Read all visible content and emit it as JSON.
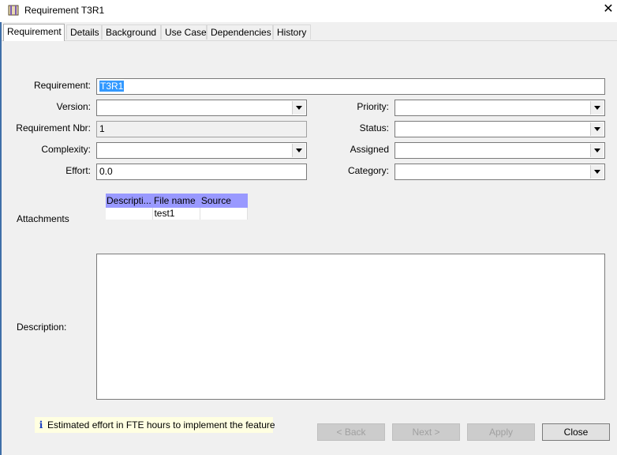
{
  "window": {
    "title": "Requirement T3R1",
    "close_glyph": "✕",
    "icon": "requirement-window-icon"
  },
  "tabs": [
    {
      "label": "Requirement",
      "active": true
    },
    {
      "label": "Details",
      "active": false
    },
    {
      "label": "Background",
      "active": false
    },
    {
      "label": "Use Case",
      "active": false
    },
    {
      "label": "Dependencies",
      "active": false
    },
    {
      "label": "History",
      "active": false
    }
  ],
  "form": {
    "requirement": {
      "label": "Requirement:",
      "value": "T3R1"
    },
    "version": {
      "label": "Version:",
      "value": ""
    },
    "requirement_nbr": {
      "label": "Requirement Nbr:",
      "value": "1"
    },
    "complexity": {
      "label": "Complexity:",
      "value": ""
    },
    "effort": {
      "label": "Effort:",
      "value": "0.0"
    },
    "priority": {
      "label": "Priority:",
      "value": ""
    },
    "status": {
      "label": "Status:",
      "value": ""
    },
    "assigned": {
      "label": "Assigned",
      "value": ""
    },
    "category": {
      "label": "Category:",
      "value": ""
    }
  },
  "attachments": {
    "label": "Attachments",
    "columns": [
      "Descripti...",
      "File name",
      "Source"
    ],
    "rows": [
      [
        "",
        "test1",
        ""
      ]
    ]
  },
  "description": {
    "label": "Description:",
    "value": ""
  },
  "hint": {
    "icon": "i",
    "text": "Estimated effort in FTE hours to implement the feature"
  },
  "buttons": {
    "back": "< Back",
    "next": "Next >",
    "apply": "Apply",
    "close": "Close"
  },
  "colors": {
    "table_header": "#9999ff",
    "selection": "#3399ff",
    "hint_bg": "#ffffe1"
  }
}
